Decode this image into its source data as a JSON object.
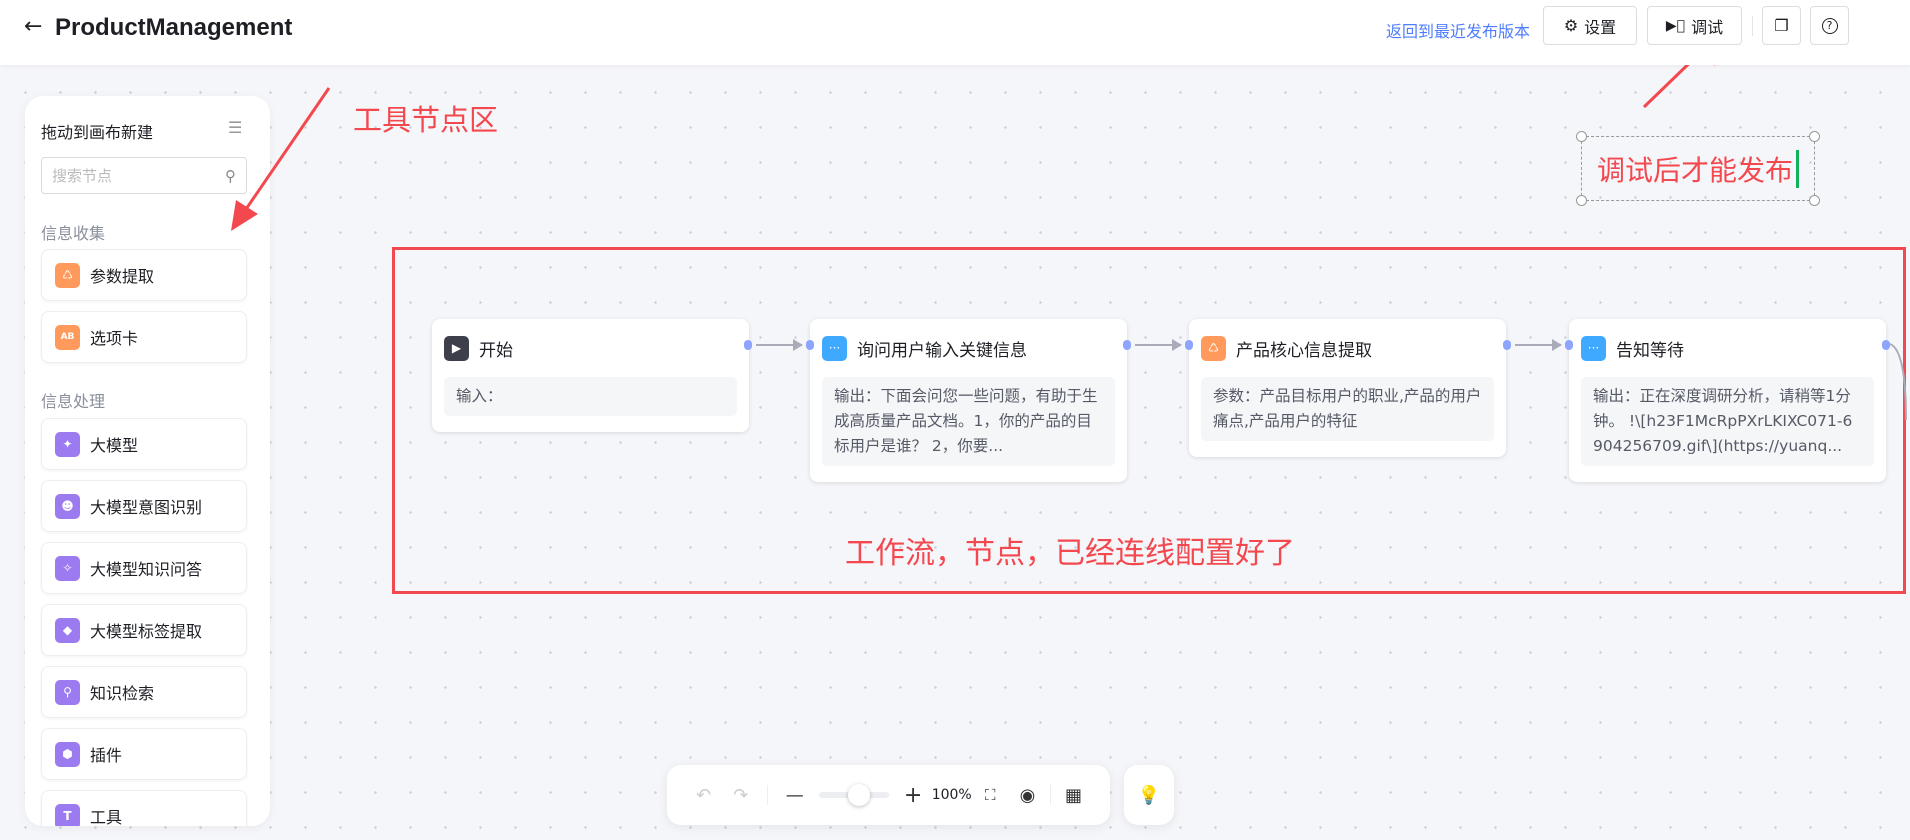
{
  "header": {
    "title": "ProductManagement",
    "revert_link": "返回到最近发布版本",
    "settings_label": "设置",
    "debug_label": "调试"
  },
  "sidebar": {
    "title": "拖动到画布新建",
    "search_placeholder": "搜索节点",
    "sections": [
      {
        "label": "信息收集",
        "items": [
          {
            "label": "参数提取",
            "icon": "extract-icon",
            "color": "#ff9a5c"
          },
          {
            "label": "选项卡",
            "icon": "ab-card-icon",
            "color": "#ff9a5c"
          }
        ]
      },
      {
        "label": "信息处理",
        "items": [
          {
            "label": "大模型",
            "icon": "sparkle-icon",
            "color": "#9c7bf0"
          },
          {
            "label": "大模型意图识别",
            "icon": "robot-icon",
            "color": "#9c7bf0"
          },
          {
            "label": "大模型知识问答",
            "icon": "chat-sparkle-icon",
            "color": "#9c7bf0"
          },
          {
            "label": "大模型标签提取",
            "icon": "tag-icon",
            "color": "#9c7bf0"
          },
          {
            "label": "知识检索",
            "icon": "search-icon",
            "color": "#9c7bf0"
          },
          {
            "label": "插件",
            "icon": "plugin-icon",
            "color": "#9c7bf0"
          },
          {
            "label": "工具",
            "icon": "tool-icon",
            "color": "#9c7bf0"
          }
        ]
      }
    ]
  },
  "nodes": [
    {
      "title": "开始",
      "body": "输入：",
      "icon": "play-icon",
      "color": "#3d3f4a"
    },
    {
      "title": "询问用户输入关键信息",
      "body": "输出：下面会问您一些问题，有助于生成高质量产品文档。1，你的产品的目标用户是谁？ 2，你要...",
      "icon": "message-icon",
      "color": "#3fa9ff"
    },
    {
      "title": "产品核心信息提取",
      "body": "参数：产品目标用户的职业,产品的用户痛点,产品用户的特征",
      "icon": "extract-icon",
      "color": "#ff9a5c"
    },
    {
      "title": "告知等待",
      "body": "输出：正在深度调研分析，请稍等1分钟。 !\\[h23F1McRpPXrLKIXC071-6904256709.gif\\](https://yuanq...",
      "icon": "message-icon",
      "color": "#3fa9ff"
    }
  ],
  "annotations": {
    "tool_area": "工具节点区",
    "workflow": "工作流，节点，已经连线配置好了",
    "debug_note": "调试后才能发布"
  },
  "toolbar": {
    "zoom": "100%",
    "zoom_fraction": 0.45
  }
}
